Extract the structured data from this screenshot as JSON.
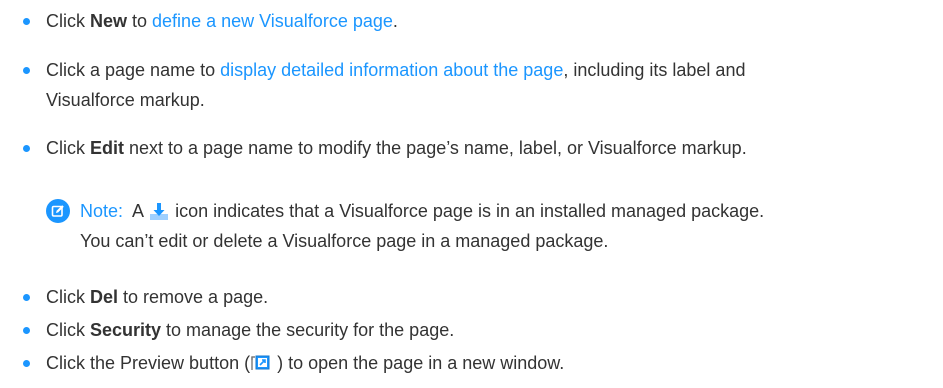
{
  "items": [
    {
      "pre": "Click ",
      "bold": "New",
      "mid": " to ",
      "link": "define a new Visualforce page",
      "post": "."
    },
    {
      "pre": "Click a page name to ",
      "link": "display detailed information about the page",
      "line1_post": ", including its label and",
      "line2": "Visualforce markup."
    },
    {
      "pre": "Click ",
      "bold": "Edit",
      "post": " next to a page name to modify the page’s name, label, or Visualforce markup."
    }
  ],
  "note": {
    "label": "Note:",
    "pre_icon": "A",
    "icon": "managed-package-icon",
    "line1_rest": "icon indicates that a Visualforce page is in an installed managed package.",
    "line2": "You can’t edit or delete a Visualforce page in a managed package."
  },
  "items2": [
    {
      "pre": "Click ",
      "bold": "Del",
      "post": " to remove a page."
    },
    {
      "pre": "Click ",
      "bold": "Security",
      "post": " to manage the security for the page."
    },
    {
      "pre": "Click the Preview button (",
      "icon": "preview-icon",
      "post": " ) to open the page in a new window."
    }
  ],
  "colors": {
    "accent": "#1b96ff",
    "text": "#333333",
    "package_icon": "#1b96ff"
  }
}
